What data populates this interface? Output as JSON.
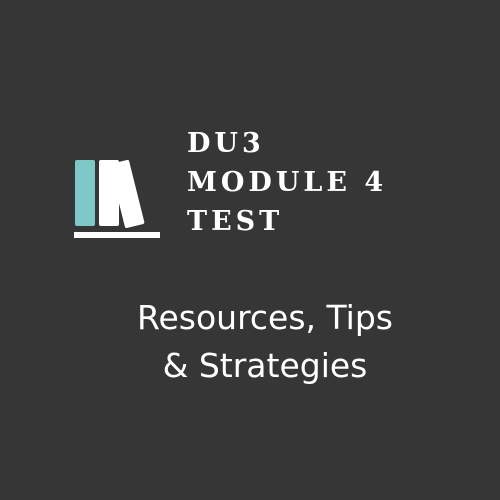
{
  "title": {
    "lines": [
      "DU3",
      "MODULE 4",
      "TEST"
    ]
  },
  "subtitle": {
    "lines": [
      "Resources, Tips",
      "& Strategies"
    ]
  },
  "logo": {
    "icon": "books-icon",
    "colors": {
      "accent_book": "#7ec8c8",
      "books": "#ffffff",
      "shelf": "#ffffff"
    }
  },
  "colors": {
    "background": "#363636",
    "text": "#ffffff"
  }
}
